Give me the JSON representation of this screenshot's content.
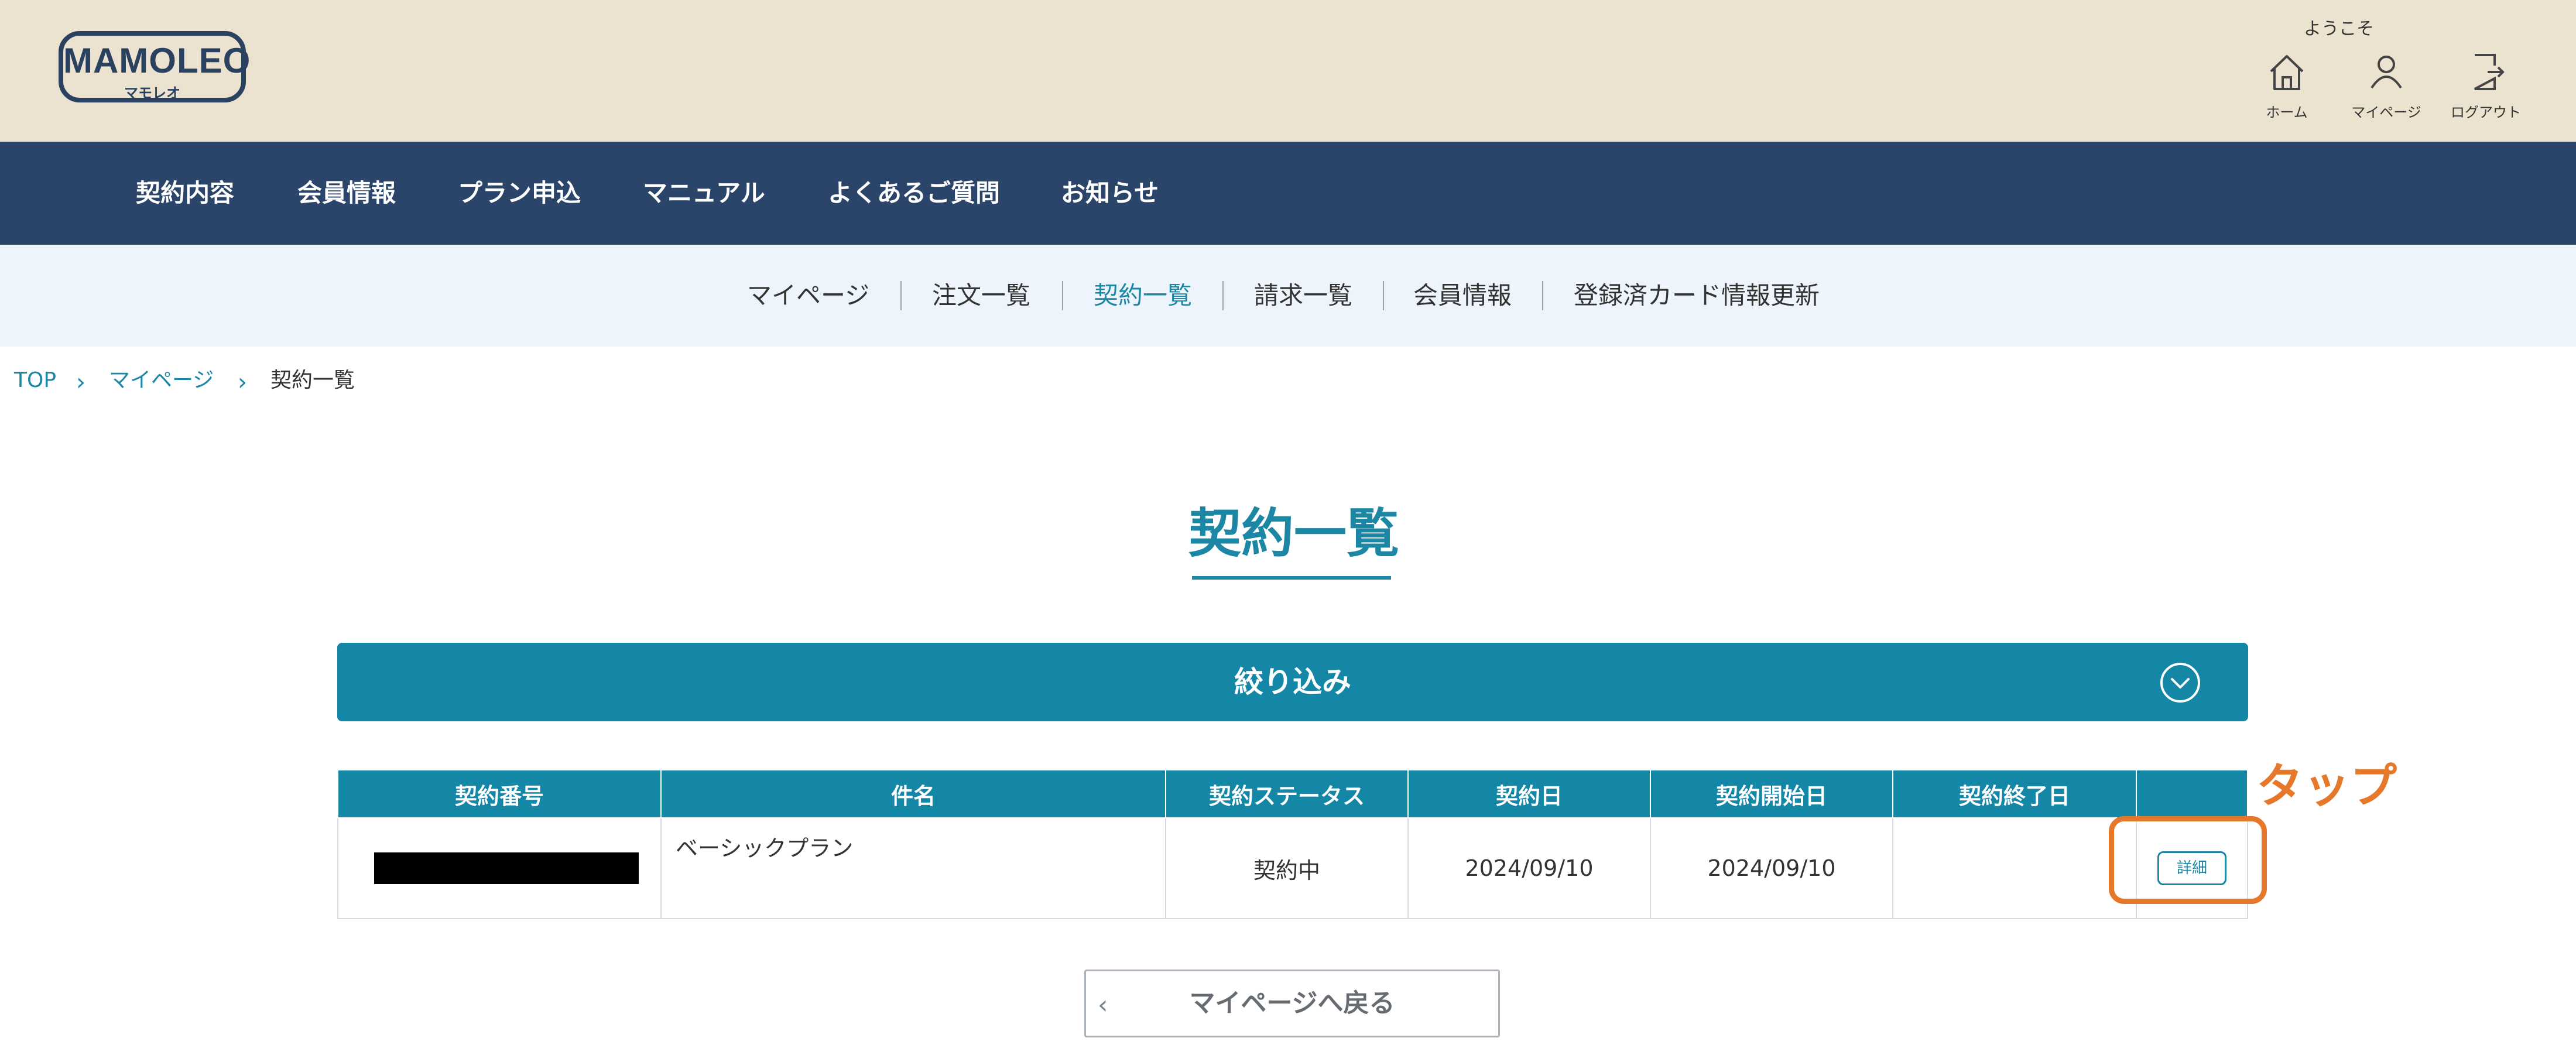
{
  "header": {
    "logo_text": "MAMOLEO",
    "logo_sub": "マモレオ",
    "welcome": "ようこそ",
    "icons": [
      {
        "label": "ホーム",
        "icon": "home-icon"
      },
      {
        "label": "マイページ",
        "icon": "user-icon"
      },
      {
        "label": "ログアウト",
        "icon": "logout-icon"
      }
    ]
  },
  "main_nav": [
    "契約内容",
    "会員情報",
    "プラン申込",
    "マニュアル",
    "よくあるご質問",
    "お知らせ"
  ],
  "sub_nav": {
    "items": [
      "マイページ",
      "注文一覧",
      "契約一覧",
      "請求一覧",
      "会員情報",
      "登録済カード情報更新"
    ],
    "active": "契約一覧"
  },
  "breadcrumb": [
    "TOP",
    "マイページ",
    "契約一覧"
  ],
  "page_title": "契約一覧",
  "filter": {
    "label": "絞り込み",
    "icon": "chevron-circle-down-icon"
  },
  "table": {
    "headers": [
      "契約番号",
      "件名",
      "契約ステータス",
      "契約日",
      "契約開始日",
      "契約終了日",
      ""
    ],
    "rows": [
      {
        "number": "",
        "name": "ベーシックプラン",
        "status": "契約中",
        "contract_date": "2024/09/10",
        "start_date": "2024/09/10",
        "end_date": "",
        "action": "詳細"
      }
    ]
  },
  "annotation": {
    "label": "タップ",
    "color": "#e6782b"
  },
  "back_button": {
    "label": "マイページへ戻る"
  },
  "colors": {
    "accent": "#1486a6",
    "navy": "#2a4569",
    "header_bg": "#ebe3cf",
    "subnav_bg": "#edf4fb"
  }
}
